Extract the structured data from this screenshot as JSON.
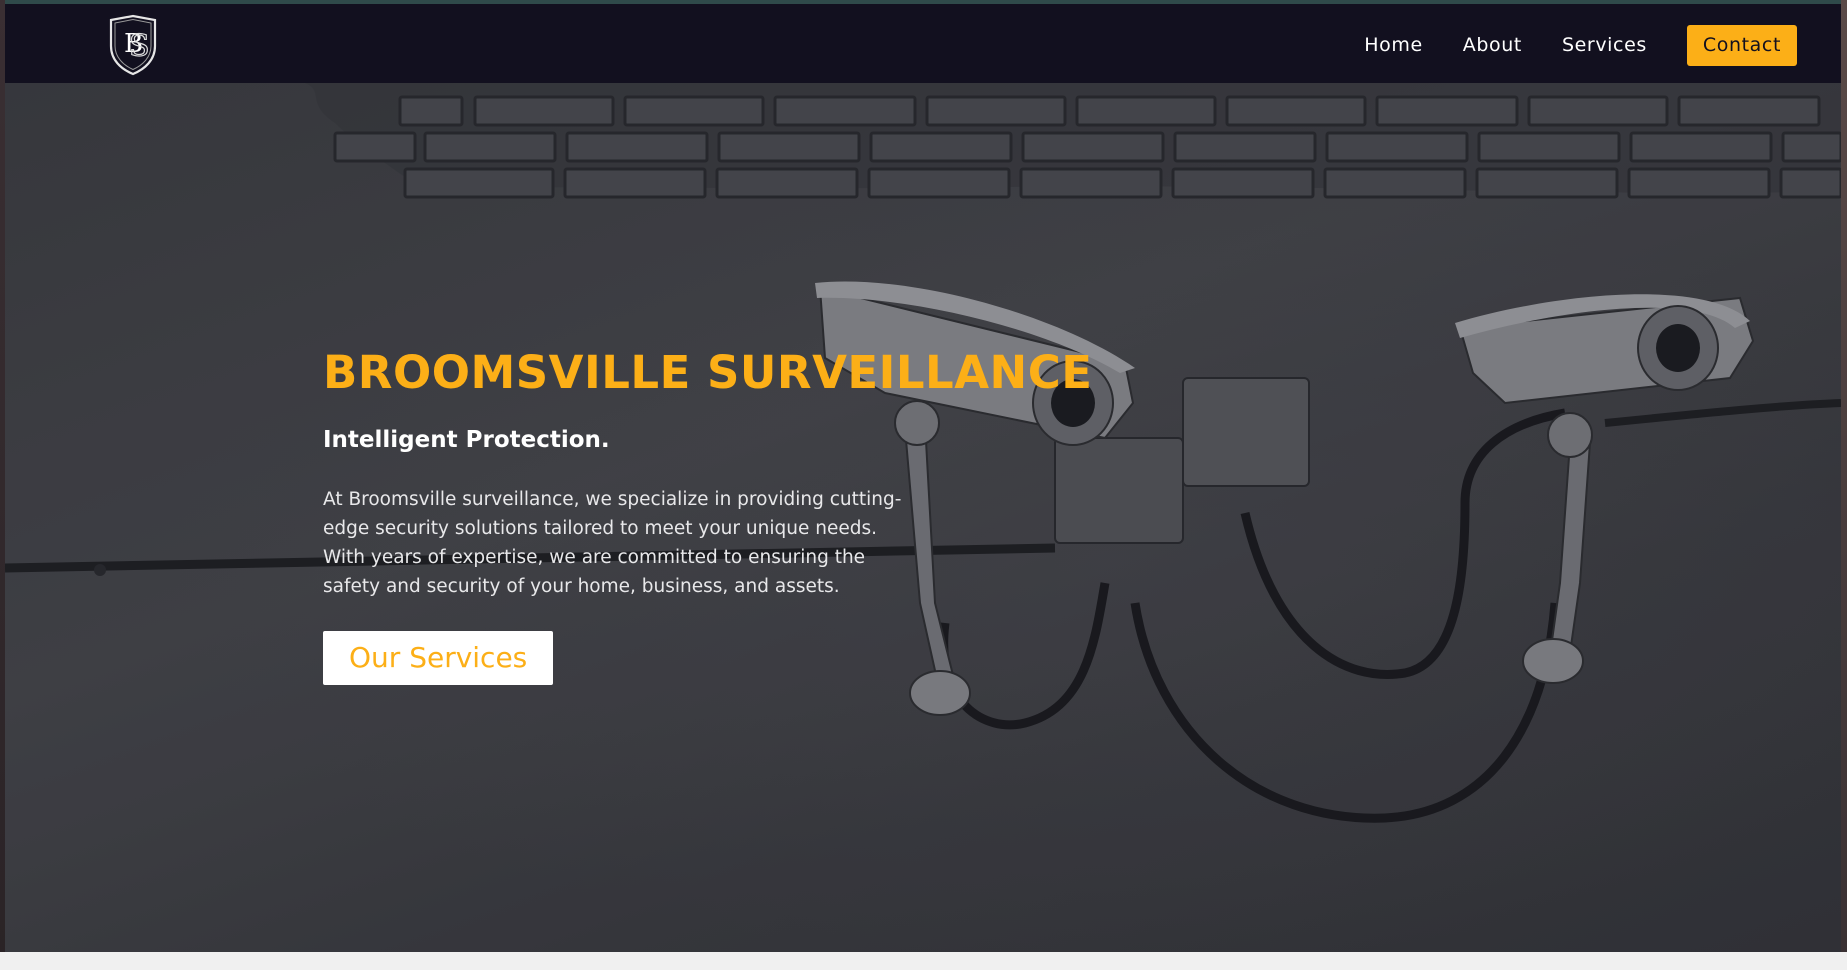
{
  "nav": {
    "logo_icon": "bs-shield-monogram-icon",
    "links": [
      "Home",
      "About",
      "Services"
    ],
    "contact_label": "Contact"
  },
  "hero": {
    "title": "BROOMSVILLE SURVEILLANCE",
    "tagline": "Intelligent Protection.",
    "description": "At Broomsville surveillance, we specialize in providing cutting-edge security solutions tailored to meet your unique needs. With years of expertise, we are committed to ensuring the safety and security of your home, business, and assets.",
    "cta_label": "Our Services",
    "background_image": "security-cameras-on-brick-wall"
  },
  "colors": {
    "accent": "#fcaf17",
    "navbar": "#12101f",
    "hero_text": "#ffffff"
  }
}
